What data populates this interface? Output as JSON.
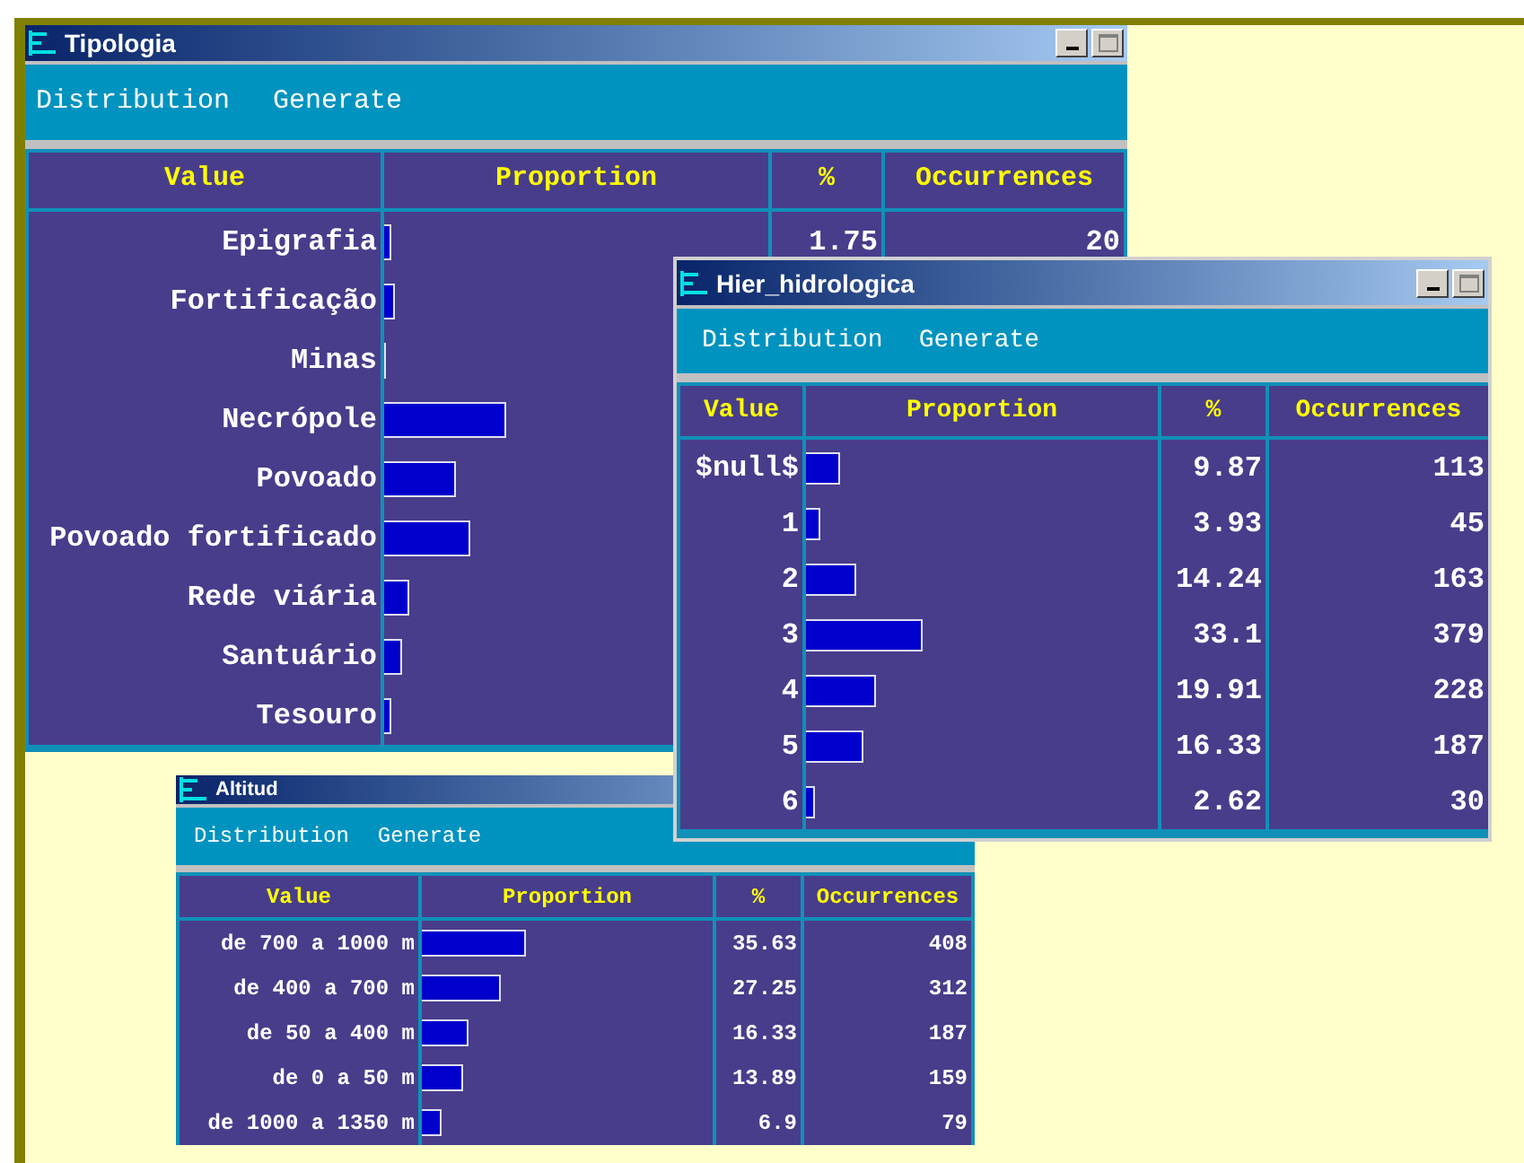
{
  "windows": [
    {
      "title": "Tipologia",
      "window_buttons": true,
      "menu": [
        "Distribution",
        "Generate"
      ],
      "columns": [
        "Value",
        "Proportion",
        "%",
        "Occurrences"
      ],
      "rows": [
        {
          "value": "Epigrafia",
          "level": 0.0175,
          "percent": "1.75",
          "occurrences": "20"
        },
        {
          "value": "Fortificação",
          "level": 0.03
        },
        {
          "value": "Minas",
          "level": 0.004
        },
        {
          "value": "Necrópole",
          "level": 0.32
        },
        {
          "value": "Povoado",
          "level": 0.185
        },
        {
          "value": "Povoado fortificado",
          "level": 0.225
        },
        {
          "value": "Rede viária",
          "level": 0.065
        },
        {
          "value": "Santuário",
          "level": 0.045
        },
        {
          "value": "Tesouro",
          "level": 0.02
        }
      ]
    },
    {
      "title": "Altitud",
      "menu": [
        "Distribution",
        "Generate"
      ],
      "columns": [
        "Value",
        "Proportion",
        "%",
        "Occurrences"
      ],
      "rows": [
        {
          "value": "de 700 a 1000 m",
          "level": 0.3563,
          "percent": "35.63",
          "occurrences": "408"
        },
        {
          "value": "de 400 a 700 m",
          "level": 0.2725,
          "percent": "27.25",
          "occurrences": "312"
        },
        {
          "value": "de 50 a 400 m",
          "level": 0.1633,
          "percent": "16.33",
          "occurrences": "187"
        },
        {
          "value": "de 0 a 50 m",
          "level": 0.1389,
          "percent": "13.89",
          "occurrences": "159"
        },
        {
          "value": "de 1000 a 1350 m",
          "level": 0.069,
          "percent": "6.9",
          "occurrences": "79"
        }
      ]
    },
    {
      "title": "Hier_hidrologica",
      "window_buttons": true,
      "menu": [
        "Distribution",
        "Generate"
      ],
      "columns": [
        "Value",
        "Proportion",
        "%",
        "Occurrences"
      ],
      "rows": [
        {
          "value": "$null$",
          "level": 0.0987,
          "percent": "9.87",
          "occurrences": "113"
        },
        {
          "value": "1",
          "level": 0.0393,
          "percent": "3.93",
          "occurrences": "45"
        },
        {
          "value": "2",
          "level": 0.1424,
          "percent": "14.24",
          "occurrences": "163"
        },
        {
          "value": "3",
          "level": 0.331,
          "percent": "33.1",
          "occurrences": "379"
        },
        {
          "value": "4",
          "level": 0.1991,
          "percent": "19.91",
          "occurrences": "228"
        },
        {
          "value": "5",
          "level": 0.1633,
          "percent": "16.33",
          "occurrences": "187"
        },
        {
          "value": "6",
          "level": 0.0262,
          "percent": "2.62",
          "occurrences": "30"
        }
      ]
    }
  ]
}
